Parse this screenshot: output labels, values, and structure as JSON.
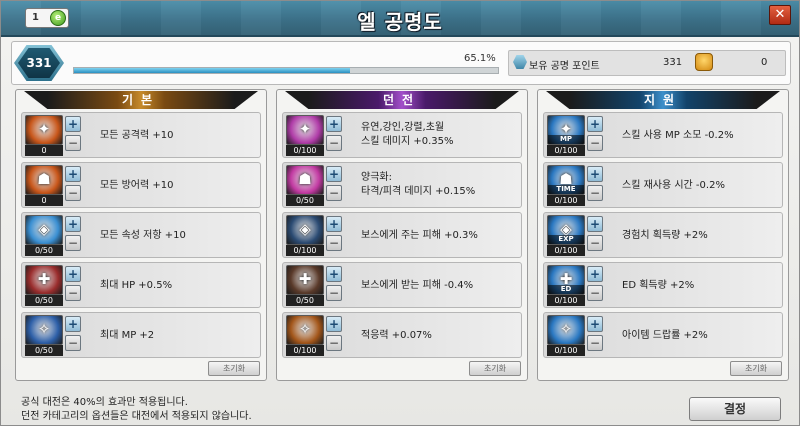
{
  "window": {
    "title": "엘 공명도",
    "level_badge": "1",
    "close_icon": "close-icon"
  },
  "resonance": {
    "level": "331",
    "percent_text": "65.1%",
    "progress": 0.651,
    "points_label": "보유 공명 포인트",
    "points_value": "331",
    "other_value": "0"
  },
  "panels": [
    {
      "title": "기본",
      "reset_label": "초기화",
      "items": [
        {
          "icon": "attack-icon",
          "count": "0",
          "label": "모든 공격력 +10",
          "color": "#c8561a"
        },
        {
          "icon": "defense-icon",
          "count": "0",
          "label": "모든 방어력 +10",
          "color": "#c8561a"
        },
        {
          "icon": "resist-icon",
          "count": "0/50",
          "label": "모든 속성 저항 +10",
          "color": "#3a8fd2"
        },
        {
          "icon": "hp-icon",
          "count": "0/50",
          "label": "최대 HP +0.5%",
          "color": "#9a2d2d"
        },
        {
          "icon": "mp-icon",
          "count": "0/50",
          "label": "최대 MP +2",
          "color": "#2d5fa8"
        }
      ]
    },
    {
      "title": "던전",
      "reset_label": "초기화",
      "items": [
        {
          "icon": "skill-damage-icon",
          "count": "0/100",
          "label1": "유연,강인,강렬,초월",
          "label2": "스킬 데미지 +0.35%",
          "color": "#b03ca8"
        },
        {
          "icon": "dual-damage-icon",
          "count": "0/50",
          "label1": "양극화:",
          "label2": "타격/피격 데미지 +0.15%",
          "color": "#c23aa2"
        },
        {
          "icon": "boss-attack-icon",
          "count": "0/100",
          "label": "보스에게 주는 피해 +0.3%",
          "color": "#2b4b73"
        },
        {
          "icon": "boss-defense-icon",
          "count": "0/50",
          "label": "보스에게 받는 피해 -0.4%",
          "color": "#5a3a2a"
        },
        {
          "icon": "adapt-icon",
          "count": "0/100",
          "label": "적응력 +0.07%",
          "color": "#a3561a"
        }
      ]
    },
    {
      "title": "지원",
      "reset_label": "초기화",
      "items": [
        {
          "icon": "mp-cost-icon",
          "tag": "MP",
          "count": "0/100",
          "label": "스킬 사용 MP 소모 -0.2%",
          "color": "#2a78c2"
        },
        {
          "icon": "cooldown-icon",
          "tag": "TIME",
          "count": "0/100",
          "label": "스킬 재사용 시간 -0.2%",
          "color": "#2a78c2"
        },
        {
          "icon": "exp-icon",
          "tag": "EXP",
          "count": "0/100",
          "label": "경험치 획득량 +2%",
          "color": "#2a78c2"
        },
        {
          "icon": "ed-icon",
          "tag": "ED",
          "count": "0/100",
          "label": "ED 획득량 +2%",
          "color": "#2a78c2"
        },
        {
          "icon": "drop-icon",
          "tag": "",
          "count": "0/100",
          "label": "아이템 드랍률 +2%",
          "color": "#2a78c2"
        }
      ]
    }
  ],
  "footer": {
    "line1": "공식 대전은 40%의 효과만 적용됩니다.",
    "line2": "던전 카테고리의 옵션들은 대전에서 적용되지 않습니다.",
    "confirm_label": "결정"
  }
}
